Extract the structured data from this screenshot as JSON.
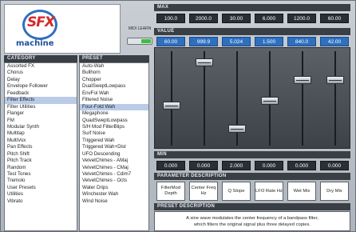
{
  "logo": {
    "sfx": "SFX",
    "machine": "machine"
  },
  "midi": {
    "label": "MIDI LEARN"
  },
  "category": {
    "header": "CATEGORY",
    "items": [
      "Assorted FX",
      "Chorus",
      "Delay",
      "Envelope Follower",
      "Feedback",
      "Filter Effects",
      "Filter Utilities",
      "Flanger",
      "FM",
      "Modular Synth",
      "Multitap",
      "MultiVox",
      "Pan Effects",
      "Pitch Shift",
      "Pitch Track",
      "Random",
      "Test Tones",
      "Tremolo",
      "User Presets",
      "Utilities",
      "Vibrato"
    ],
    "selected_index": 5
  },
  "preset": {
    "header": "PRESET",
    "items": [
      "Auto-Wah",
      "Bullhorn",
      "Chopper",
      "DualSweptLowpass",
      "EnvFol Wah",
      "Filtered Noise",
      "Four-Fold Wah",
      "Megaphone",
      "QuadSweptLowpass",
      "S/H Mod FilterBlips",
      "Surf Noise",
      "Triggered Wah",
      "Triggered Wah+Dist",
      "UFO Descending",
      "VelvetChimes - AMaj",
      "VelvetChimes - CMaj",
      "VelvetChimes - Cdim7",
      "VelvetChimes - Octs",
      "Water Drips",
      "Winchester Wah",
      "Wind Noise"
    ],
    "selected_index": 6
  },
  "max": {
    "header": "MAX",
    "values": [
      "100.0",
      "2000.0",
      "30.00",
      "6.000",
      "1200.0",
      "60.00"
    ]
  },
  "value": {
    "header": "VALUE",
    "values": [
      "60.00",
      "999.9",
      "5.024",
      "1.500",
      "840.0",
      "42.00"
    ]
  },
  "sliders": [
    0.42,
    0.92,
    0.15,
    0.47,
    0.71,
    0.71
  ],
  "min": {
    "header": "MIN",
    "values": [
      "0.000",
      "0.000",
      "2.000",
      "0.000",
      "0.000",
      "0.000"
    ]
  },
  "param": {
    "header": "PARAMETER DESCRIPTION",
    "buttons": [
      "FilterMod Depth",
      "Center Freq Hz",
      "Q Slope",
      "LFO Rate Hz",
      "Wet Mix",
      "Dry Mix"
    ]
  },
  "preset_desc": {
    "header": "PRESET DESCRIPTION",
    "line1": "A sine wave modulates the center frequency of a bandpass filter,",
    "line2": "which filters the original signal plus three delayed copies."
  },
  "colors": {
    "accent": "#2e6fbf",
    "selection": "#b9cbe6",
    "panel_header": "#3a3f46"
  }
}
